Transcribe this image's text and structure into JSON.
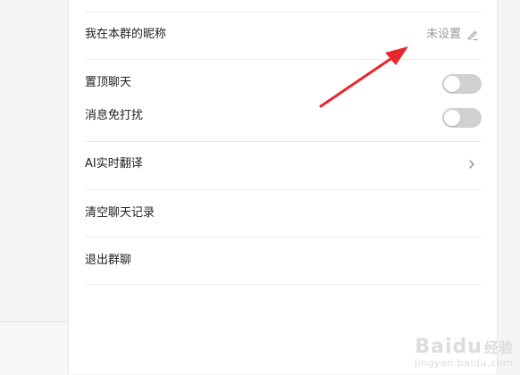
{
  "settings": {
    "nickname": {
      "label": "我在本群的昵称",
      "value": "未设置"
    },
    "pin_chat": {
      "label": "置顶聊天",
      "enabled": false
    },
    "mute": {
      "label": "消息免打扰",
      "enabled": false
    },
    "ai_translate": {
      "label": "AI实时翻译"
    },
    "clear_history": {
      "label": "清空聊天记录"
    },
    "leave_group": {
      "label": "退出群聊"
    }
  },
  "annotation": {
    "arrow_color": "#e8262b"
  },
  "watermark": {
    "brand": "Baidu",
    "brand_cn": "经验",
    "url": "jingyan.baidu.com"
  },
  "colors": {
    "toggle_off": "#cfd0d2",
    "divider": "#ebebeb",
    "muted_text": "#9a9a9a"
  }
}
